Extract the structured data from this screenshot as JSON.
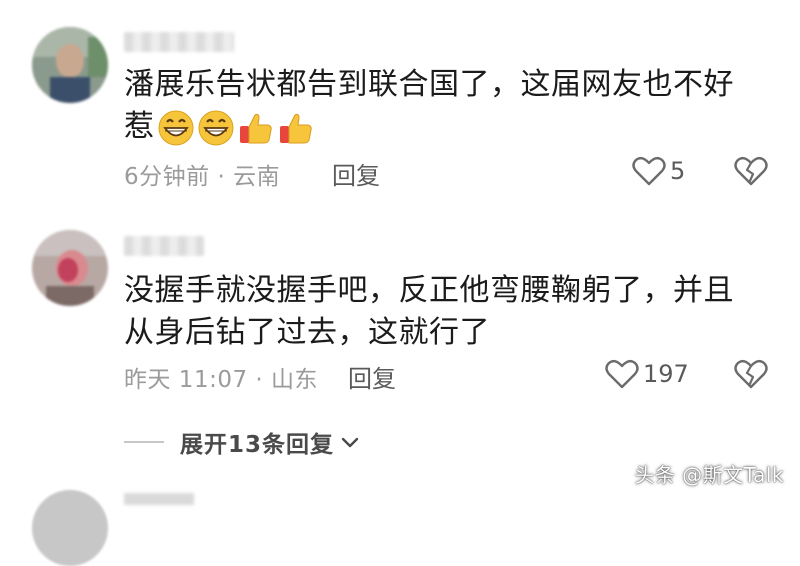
{
  "comments": [
    {
      "text_line1": "潘展乐告状都告到联合国了，这届网友也不好",
      "text_line2": "惹",
      "emojis": [
        "grinning-face",
        "grinning-face",
        "thumbs-up",
        "thumbs-up"
      ],
      "meta": "6分钟前 · 云南",
      "reply_label": "回复",
      "likes": "5"
    },
    {
      "text_line1": "没握手就没握手吧，反正他弯腰鞠躬了，并且",
      "text_line2": "从身后钻了过去，这就行了",
      "meta": "昨天 11:07 · 山东",
      "reply_label": "回复",
      "likes": "197"
    }
  ],
  "expand_replies": "展开13条回复",
  "watermark": "头条 @斯文Talk",
  "colors": {
    "meta_gray": "#9b9b9b",
    "emoji_yellow": "#f7c53b",
    "thumb_red": "#e8453c"
  }
}
